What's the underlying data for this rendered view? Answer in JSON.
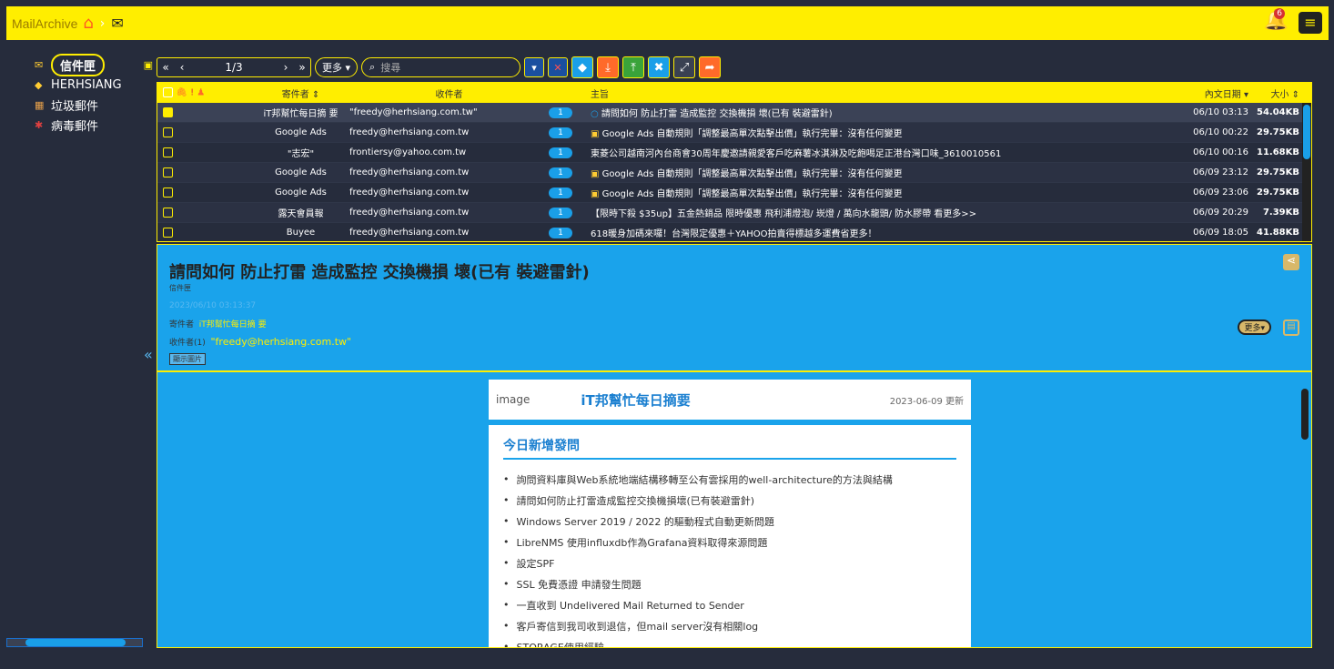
{
  "app": {
    "brand": "MailArchive",
    "breadcrumb_sep": "›",
    "notification_count": "6"
  },
  "sidebar": {
    "items": [
      {
        "label": "信件匣",
        "icon": "envelope-icon"
      },
      {
        "label": "HERHSIANG",
        "icon": "tag-icon"
      },
      {
        "label": "垃圾郵件",
        "icon": "trash-icon"
      },
      {
        "label": "病毒郵件",
        "icon": "virus-icon"
      }
    ]
  },
  "toolbar": {
    "page": "1/3",
    "more_label": "更多",
    "search_placeholder": "搜尋"
  },
  "grid": {
    "headers": {
      "from": "寄件者",
      "to": "收件者",
      "subject": "主旨",
      "date": "內文日期",
      "size": "大小"
    },
    "rows": [
      {
        "checked": true,
        "from": "iT邦幫忙每日摘 要",
        "to": "\"freedy@herhsiang.com.tw\"",
        "count": "1",
        "subject": "請問如何 防止打雷 造成監控 交換機損 壞(已有 裝避雷針)",
        "date": "06/10 03:13",
        "size": "54.04KB"
      },
      {
        "checked": false,
        "from": "Google Ads",
        "to": "freedy@herhsiang.com.tw",
        "count": "1",
        "subject": "Google Ads 自動規則「調整最高單次點擊出價」執行完畢：沒有任何變更",
        "date": "06/10 00:22",
        "size": "29.75KB"
      },
      {
        "checked": false,
        "from": "\"志宏\"",
        "to": "frontiersy@yahoo.com.tw",
        "count": "1",
        "subject": "東菱公司越南河內台商會30周年慶邀請親愛客戶吃麻薯冰淇淋及吃飽喝足正港台灣口味_3610010561",
        "date": "06/10 00:16",
        "size": "11.68KB"
      },
      {
        "checked": false,
        "from": "Google Ads",
        "to": "freedy@herhsiang.com.tw",
        "count": "1",
        "subject": "Google Ads 自動規則「調整最高單次點擊出價」執行完畢：沒有任何變更",
        "date": "06/09 23:12",
        "size": "29.75KB"
      },
      {
        "checked": false,
        "from": "Google Ads",
        "to": "freedy@herhsiang.com.tw",
        "count": "1",
        "subject": "Google Ads 自動規則「調整最高單次點擊出價」執行完畢：沒有任何變更",
        "date": "06/09 23:06",
        "size": "29.75KB"
      },
      {
        "checked": false,
        "from": "露天會員報",
        "to": "freedy@herhsiang.com.tw",
        "count": "1",
        "subject": "【限時下殺 $35up】五金熱銷品 限時優惠 飛利浦燈泡/ 崁燈 / 萬向水龍頭/ 防水膠帶 看更多>>",
        "date": "06/09 20:29",
        "size": "7.39KB"
      },
      {
        "checked": false,
        "from": "Buyee",
        "to": "freedy@herhsiang.com.tw",
        "count": "1",
        "subject": "618暖身加碼來囉！台灣限定優惠＋YAHOO拍賣得標越多運費省更多！",
        "date": "06/09 18:05",
        "size": "41.88KB"
      }
    ]
  },
  "preview": {
    "title": "請問如何 防止打雷 造成監控 交換機損 壞(已有 裝避雷針)",
    "folder": "信件匣",
    "date": "2023/06/10 03:13:37",
    "from_label": "寄件者",
    "from_value": "iT邦幫忙每日摘 要",
    "to_label": "收件者(1)",
    "to_value": "\"freedy@herhsiang.com.tw\"",
    "show_images": "顯示圖片",
    "more_label": "更多"
  },
  "mail": {
    "image_alt": "image",
    "brand": "iT邦幫忙每日摘要",
    "date": "2023-06-09 更新",
    "section": "今日新增發問",
    "items": [
      "詢問資料庫與Web系統地端結構移轉至公有雲採用的well-architecture的方法與結構",
      "請問如何防止打雷造成監控交換機損壞(已有裝避雷針)",
      "Windows Server 2019 / 2022 的驅動程式自動更新問題",
      "LibreNMS 使用influxdb作為Grafana資料取得來源問題",
      "設定SPF",
      "SSL 免費憑證 申請發生問題",
      "一直收到 Undelivered Mail Returned to Sender",
      "客戶寄信到我司收到退信，但mail server沒有相關log",
      "STORAGE使用經驗"
    ]
  }
}
